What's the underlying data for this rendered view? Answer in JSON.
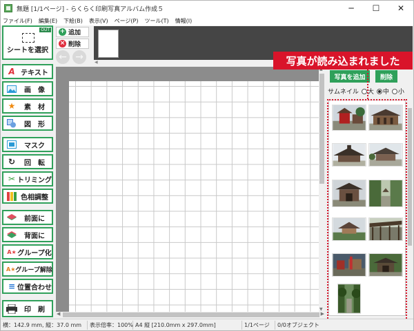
{
  "window": {
    "title": "無題 [1/1ページ] - らくらく印刷写真アルバム作成５",
    "minimize": "─",
    "maximize": "☐",
    "close": "✕"
  },
  "menu": [
    "ファイル(F)",
    "編集(E)",
    "下絵(B)",
    "表示(V)",
    "ページ(P)",
    "ツール(T)",
    "情報(I)"
  ],
  "left_toolbar": {
    "sheet_select": {
      "label": "シートを選択",
      "badge": "OUT"
    },
    "tools": [
      {
        "label": "テキスト",
        "icon": "text-a-icon",
        "glyph": "A",
        "color": "#e0303a"
      },
      {
        "label": "画　像",
        "icon": "image-icon",
        "glyph": "▬",
        "color": "#2a9ad6"
      },
      {
        "label": "素　材",
        "icon": "star-icon",
        "glyph": "★",
        "color": "#f08a10"
      },
      {
        "label": "図　形",
        "icon": "shapes-icon",
        "glyph": "◧",
        "color": "#3a7ad6"
      },
      {
        "label": "マスク",
        "icon": "mask-icon",
        "glyph": "▣",
        "color": "#2a9ad6"
      },
      {
        "label": "回　転",
        "icon": "rotate-icon",
        "glyph": "↻",
        "color": "#222222"
      },
      {
        "label": "トリミング",
        "icon": "scissors-icon",
        "glyph": "✂",
        "color": "#3aa040"
      },
      {
        "label": "色相調整",
        "icon": "color-adjust-icon",
        "glyph": "▮",
        "color": "#e0803a"
      },
      {
        "label": "前面に",
        "icon": "bring-front-icon",
        "glyph": "◆",
        "color": "#e05060"
      },
      {
        "label": "背面に",
        "icon": "send-back-icon",
        "glyph": "◆",
        "color": "#3aa060"
      },
      {
        "label": "グループ化",
        "icon": "group-icon",
        "glyph": "A★",
        "color": "#e04040"
      },
      {
        "label": "グループ解除",
        "icon": "ungroup-icon",
        "glyph": "A★",
        "color": "#e08020"
      },
      {
        "label": "位置合わせ",
        "icon": "align-icon",
        "glyph": "≡",
        "color": "#2a7ad6"
      },
      {
        "label": "印　刷",
        "icon": "printer-icon",
        "glyph": "▀",
        "color": "#333333"
      }
    ]
  },
  "page_controls": {
    "add_label": "追加",
    "delete_label": "削除",
    "back_arrow": "←",
    "forward_arrow": "→"
  },
  "right_panel": {
    "load_button": "写真を追加",
    "delete_button": "削除",
    "thumbnail_label": "サムネイル",
    "sizes": [
      {
        "label": "大",
        "selected": false
      },
      {
        "label": "中",
        "selected": true
      },
      {
        "label": "小",
        "selected": false
      }
    ]
  },
  "callout": "写真が読み込まれました",
  "statusbar": {
    "size": "横：142.9 mm, 縦：37.0 mm",
    "zoom": "表示倍率：100%",
    "paper": "A4 縦 [210.0mm x 297.0mm]",
    "page": "1/1ページ",
    "objects": "0/0オブジェクト"
  }
}
